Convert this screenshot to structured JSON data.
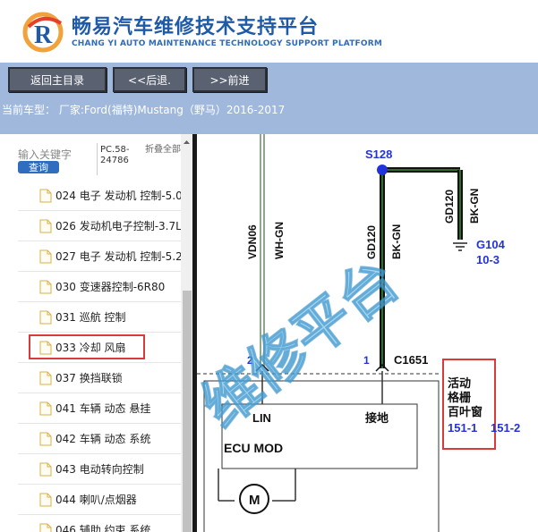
{
  "header": {
    "title": "畅易汽车维修技术支持平台",
    "subtitle": "CHANG YI AUTO MAINTENANCE TECHNOLOGY SUPPORT PLATFORM"
  },
  "nav": {
    "home": "返回主目录",
    "back": "<<后退.",
    "forward": ">>前进"
  },
  "car_info": "当前车型： 厂家:Ford(福特)Mustang（野马）2016-2017",
  "sidebar": {
    "search_placeholder": "输入关键字",
    "search_button": "查询",
    "pc_text": "PC.58-24786",
    "fold_text": "折叠全部",
    "items": [
      {
        "label": "024 电子 发动机 控制-5.0"
      },
      {
        "label": "026 发动机电子控制-3.7L"
      },
      {
        "label": "027 电子 发动机 控制-5.2"
      },
      {
        "label": "030 变速器控制-6R80"
      },
      {
        "label": "031 巡航 控制"
      },
      {
        "label": "033 冷却 风扇"
      },
      {
        "label": "037 换挡联锁"
      },
      {
        "label": "041 车辆 动态 悬挂"
      },
      {
        "label": "042 车辆 动态 系统"
      },
      {
        "label": "043 电动转向控制"
      },
      {
        "label": "044 喇叭/点烟器"
      },
      {
        "label": "046 辅助 约束 系统"
      }
    ]
  },
  "diagram": {
    "splice": "S128",
    "wire_vdn06": "VDN06",
    "wire_whgn": "WH-GN",
    "wire_gd120_a": "GD120",
    "wire_bkgn_a": "BK-GN",
    "wire_gd120_b": "GD120",
    "wire_bkgn_b": "BK-GN",
    "ground": "G104",
    "ground_ref": "10-3",
    "pin_2": "2",
    "pin_1": "1",
    "connector": "C1651",
    "lin": "LIN",
    "gnd_label": "接地",
    "module": "ECU MOD",
    "motor": "M",
    "shutter_line1": "活动",
    "shutter_line2": "格栅",
    "shutter_line3": "百叶窗",
    "ref_a": "151-1",
    "ref_b": "151-2",
    "watermark": "维修平台"
  },
  "colors": {
    "nav_bg": "#9fb8dc",
    "button_bg": "#5a6272",
    "brand_blue": "#1e5aa8",
    "highlight_red": "#d93a3a",
    "watermark": "#5ab4e6",
    "wire_blue": "#2233dd"
  }
}
